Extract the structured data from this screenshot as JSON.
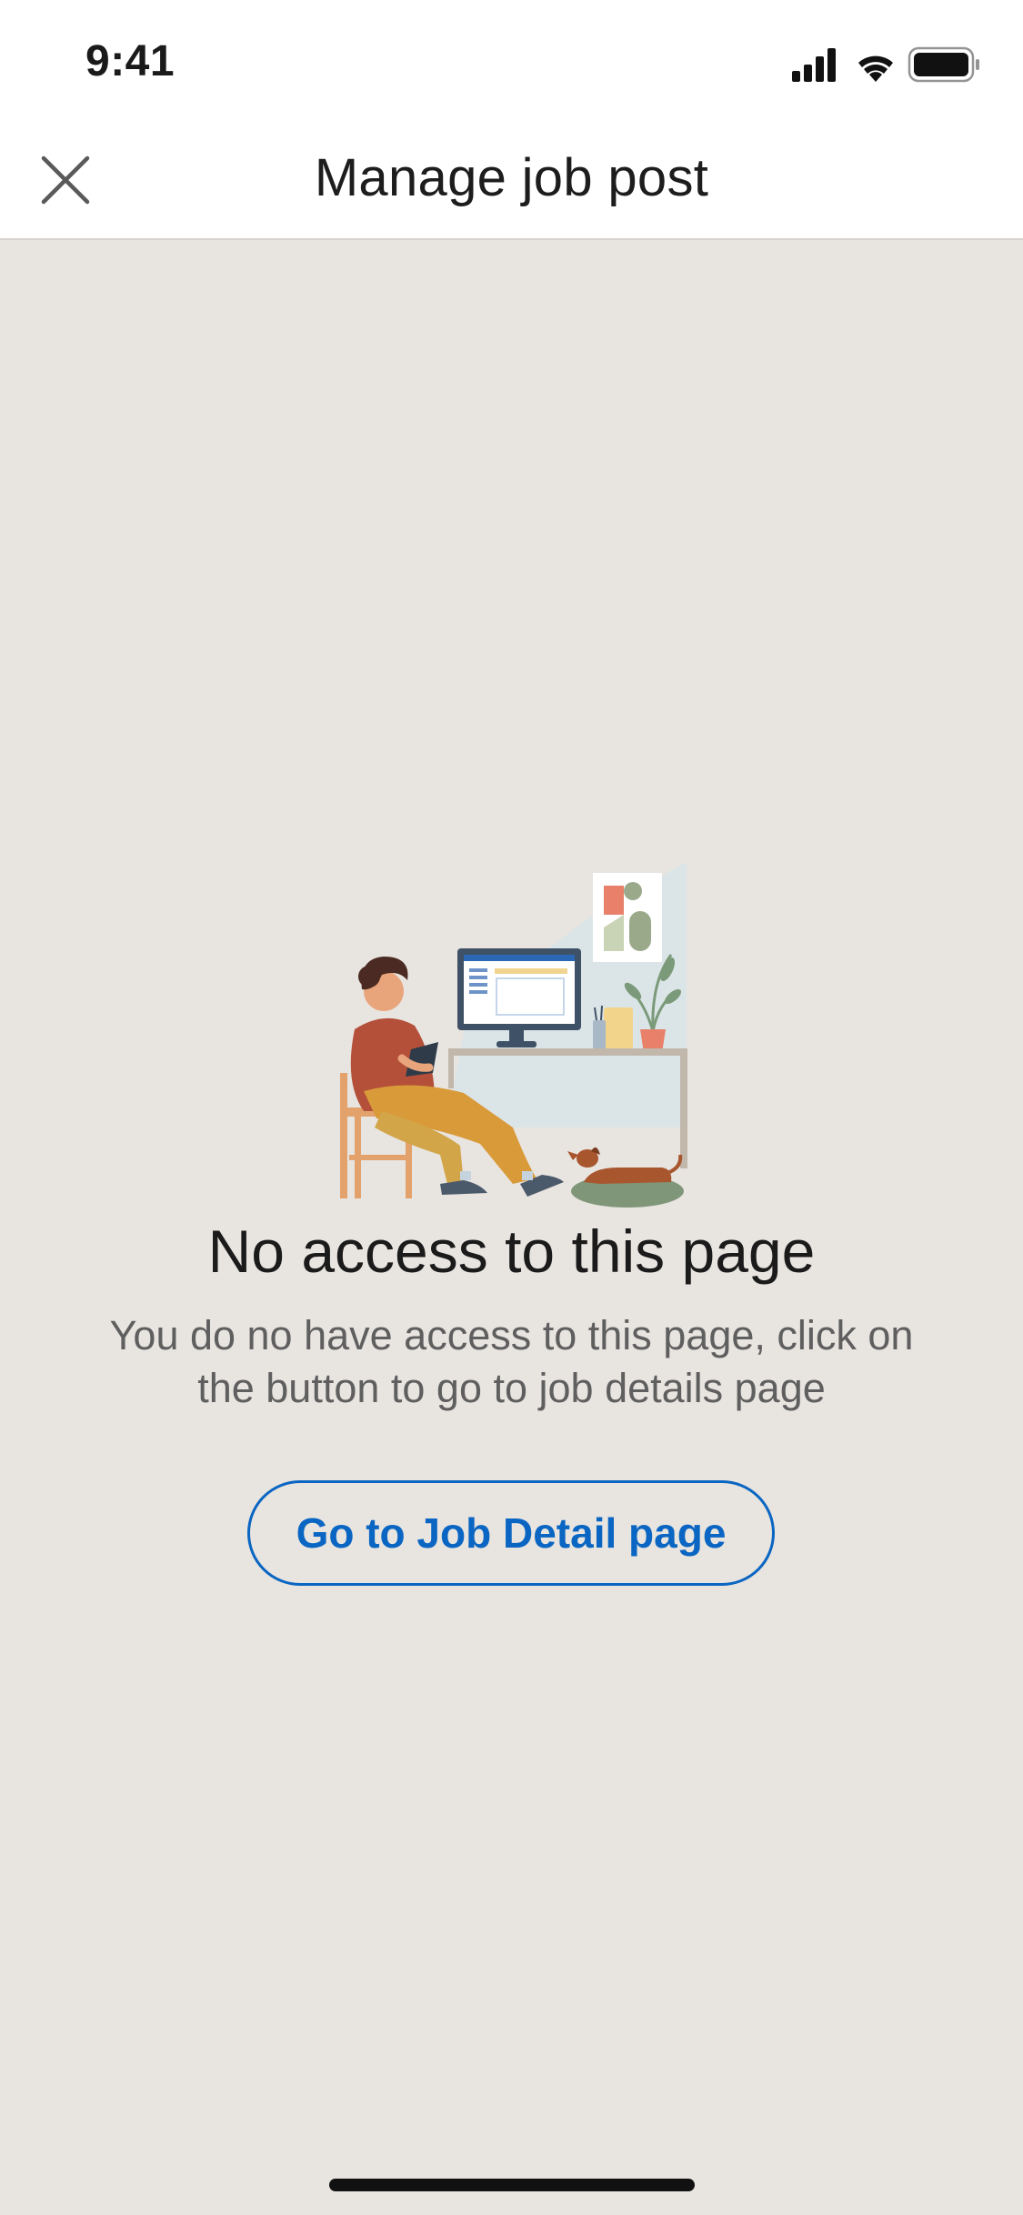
{
  "status_bar": {
    "time": "9:41",
    "icons": [
      "signal-icon",
      "wifi-icon",
      "battery-icon"
    ]
  },
  "nav": {
    "title": "Manage job post",
    "close_icon": "close-icon"
  },
  "empty_state": {
    "heading": "No access to this page",
    "body": "You do no have access to this page, click on the button to go to job details page",
    "button_label": "Go to Job Detail page"
  },
  "colors": {
    "background": "#e8e4e0",
    "accent": "#0a66c2",
    "header_bg": "#ffffff"
  }
}
